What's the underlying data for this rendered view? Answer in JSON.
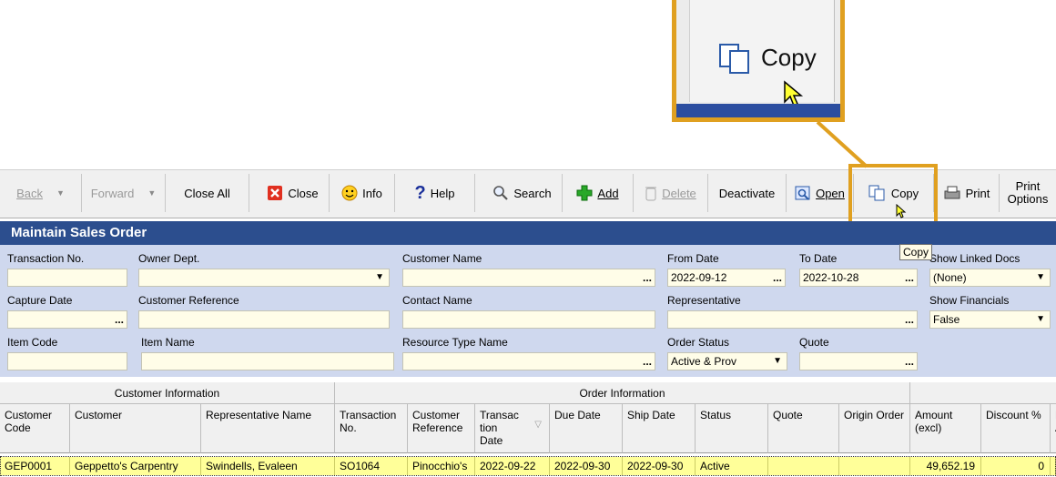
{
  "zoom": {
    "label": "Copy"
  },
  "toolbar": {
    "back": "Back",
    "forward": "Forward",
    "close_all": "Close All",
    "close": "Close",
    "info": "Info",
    "help": "Help",
    "search": "Search",
    "add": "Add",
    "delete": "Delete",
    "deactivate": "Deactivate",
    "open": "Open",
    "copy": "Copy",
    "print": "Print",
    "print_options_1": "Print",
    "print_options_2": "Options"
  },
  "tooltip": "Copy",
  "window_title": "Maintain Sales Order",
  "filters": {
    "transaction_no": {
      "label": "Transaction No.",
      "value": ""
    },
    "owner_dept": {
      "label": "Owner Dept.",
      "value": ""
    },
    "customer_name": {
      "label": "Customer Name",
      "value": ""
    },
    "from_date": {
      "label": "From Date",
      "value": "2022-09-12"
    },
    "to_date": {
      "label": "To Date",
      "value": "2022-10-28"
    },
    "show_linked_docs": {
      "label": "Show Linked Docs",
      "value": "(None)"
    },
    "capture_date": {
      "label": "Capture Date",
      "value": ""
    },
    "customer_reference": {
      "label": "Customer Reference",
      "value": ""
    },
    "contact_name": {
      "label": "Contact Name",
      "value": ""
    },
    "representative": {
      "label": "Representative",
      "value": ""
    },
    "show_financials": {
      "label": "Show Financials",
      "value": "False"
    },
    "item_code": {
      "label": "Item Code",
      "value": ""
    },
    "item_name": {
      "label": "Item Name",
      "value": ""
    },
    "resource_type_name": {
      "label": "Resource Type Name",
      "value": ""
    },
    "order_status": {
      "label": "Order Status",
      "value": "Active & Prov"
    },
    "quote": {
      "label": "Quote",
      "value": ""
    },
    "ellipsis": "...",
    "dropdown_arrow": "▼"
  },
  "grid": {
    "groups": [
      "Customer Information",
      "Order Information"
    ],
    "columns": [
      "Customer Code",
      "Customer",
      "Representative Name",
      "Transaction No.",
      "Customer Reference",
      "Transac tion Date",
      "Due Date",
      "Ship Date",
      "Status",
      "Quote",
      "Origin Order",
      "Amount (excl)",
      "Discount %",
      "D A"
    ],
    "rows": [
      [
        "GEP0001",
        "Geppetto's Carpentry",
        "Swindells, Evaleen",
        "SO1064",
        "Pinocchio's",
        "2022-09-22",
        "2022-09-30",
        "2022-09-30",
        "Active",
        "",
        "",
        "49,652.19",
        "0",
        ""
      ]
    ]
  },
  "colors": {
    "accent": "#e0a020",
    "title_bar": "#2c4e8e",
    "filter_panel": "#cfd8ee",
    "selected_row": "#ffff99"
  }
}
